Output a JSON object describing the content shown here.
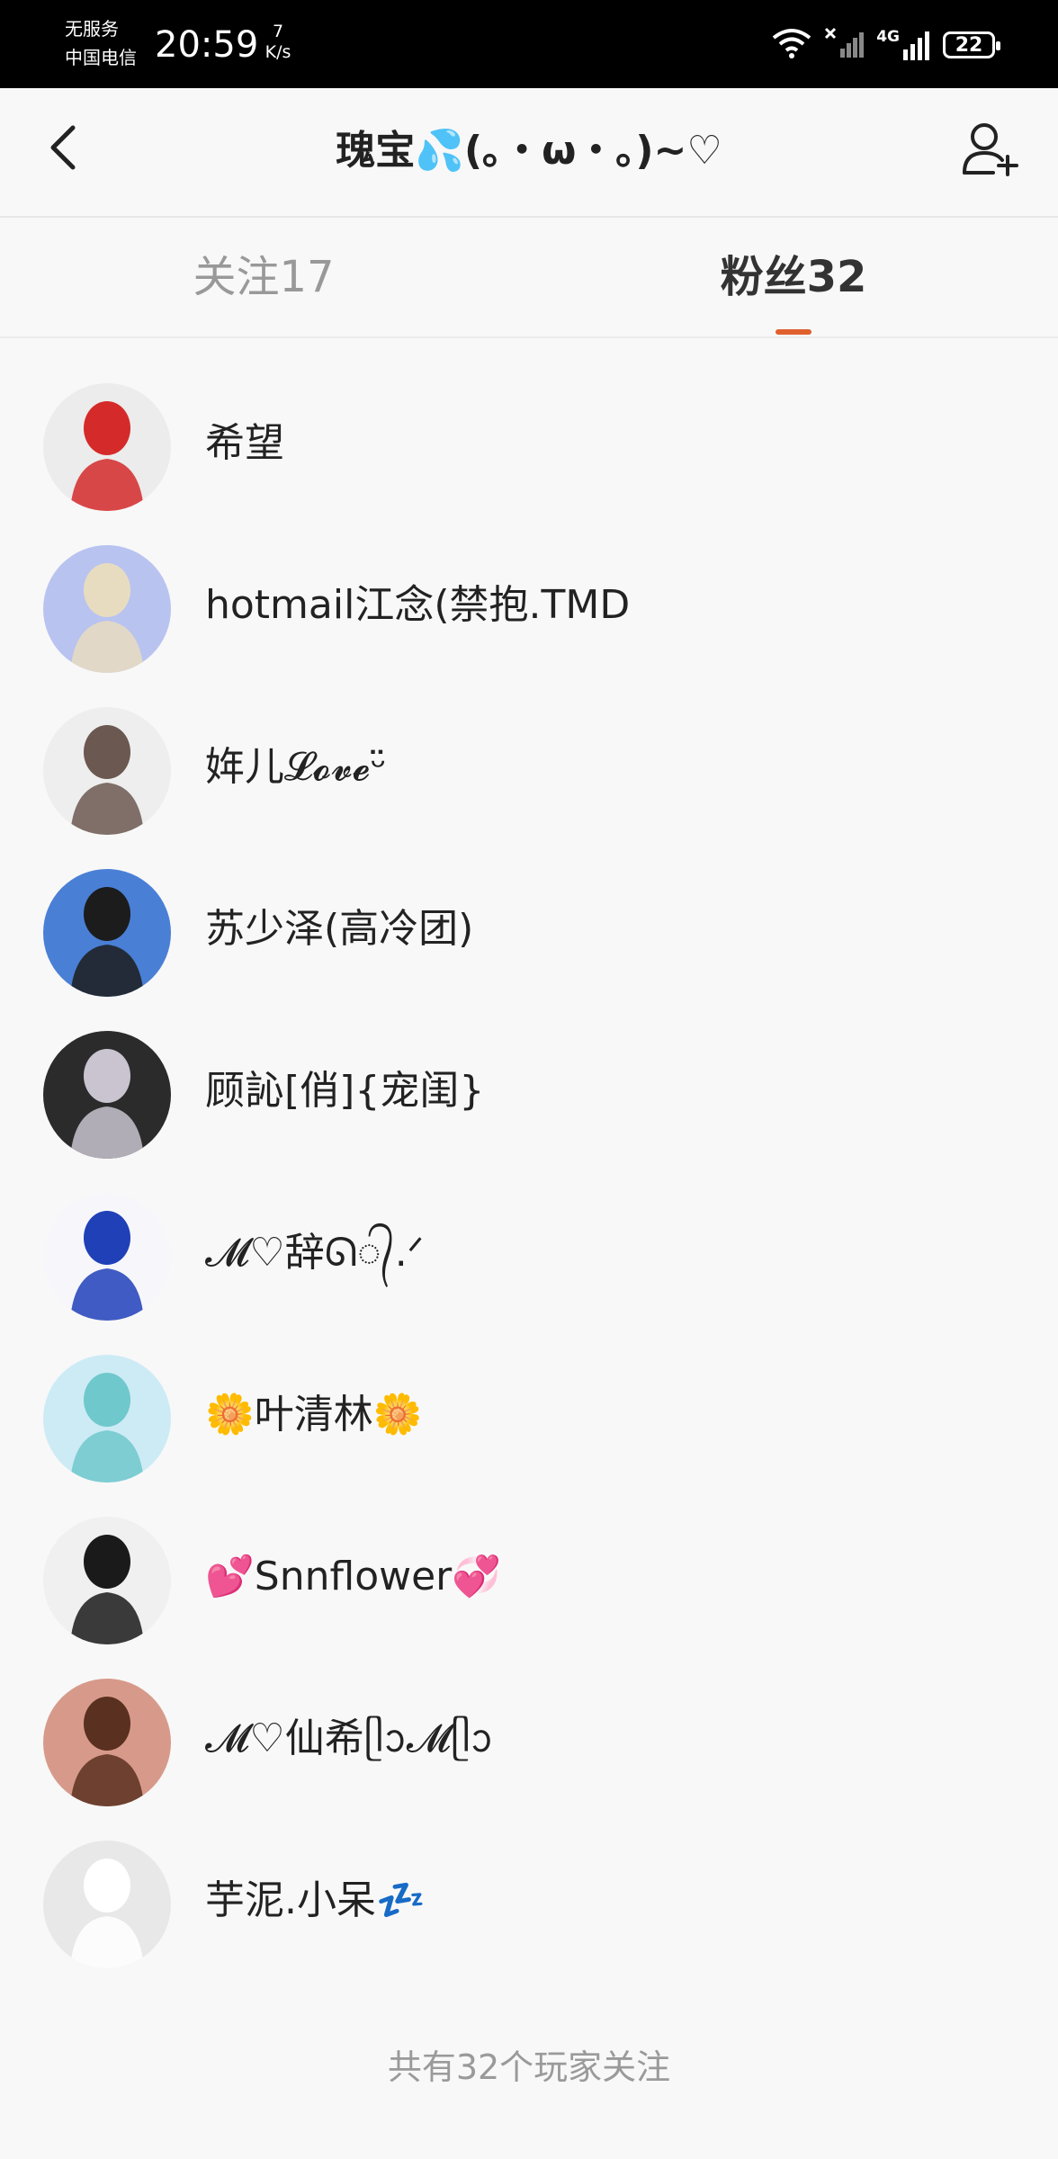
{
  "status_bar": {
    "no_service": "无服务",
    "carrier": "中国电信",
    "time": "20:59",
    "speed_value": "7",
    "speed_unit": "K/s",
    "network": "4G",
    "battery": "22"
  },
  "header": {
    "title": "瑰宝💦(｡・ω・｡)~♡",
    "back_icon": "chevron-left-icon",
    "add_icon": "add-user-icon"
  },
  "tabs": [
    {
      "label": "关注17",
      "active": false
    },
    {
      "label": "粉丝32",
      "active": true
    }
  ],
  "accent_color": "#e0602e",
  "followers": [
    {
      "name": "希望",
      "avatar_bg": "#ececec",
      "avatar_fg": "#d52a2a"
    },
    {
      "name": "hotmail江念(禁抱.TMD",
      "avatar_bg": "#b8c3f0",
      "avatar_fg": "#e8dcc0"
    },
    {
      "name": "姩儿𝓛𝓸𝓿𝓮ᵕ̈",
      "avatar_bg": "#eeeeee",
      "avatar_fg": "#6b5850"
    },
    {
      "name": "苏少泽(高冷团)",
      "avatar_bg": "#4a7fd6",
      "avatar_fg": "#1c1c1c"
    },
    {
      "name": "顾訫[俏]{宠闺}",
      "avatar_bg": "#2b2b2b",
      "avatar_fg": "#c9c4cf"
    },
    {
      "name": "𝓜♡辞ᘏ᭄.ᐟ",
      "avatar_bg": "#f7f7fb",
      "avatar_fg": "#2040b8"
    },
    {
      "name": "🌼叶清林🌼",
      "avatar_bg": "#cdebf5",
      "avatar_fg": "#6fc8cc"
    },
    {
      "name": "💕Snnflower💞",
      "avatar_bg": "#f0f0f0",
      "avatar_fg": "#1a1a1a"
    },
    {
      "name": "𝓜♡仙希ᥫᩣ𝓜ᥫᩣ",
      "avatar_bg": "#d79a8a",
      "avatar_fg": "#5a3020"
    },
    {
      "name": "芋泥.小呆💤",
      "avatar_bg": "#e8e8e8",
      "avatar_fg": "#ffffff"
    }
  ],
  "footer": "共有32个玩家关注"
}
